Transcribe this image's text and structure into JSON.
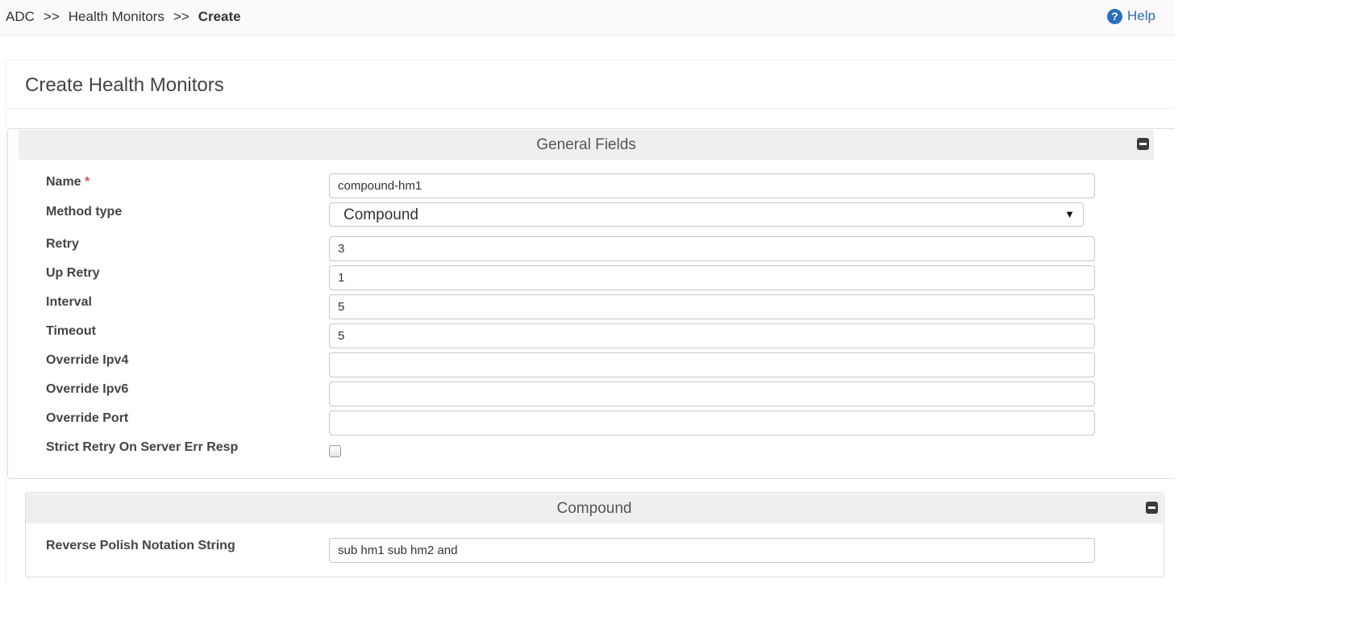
{
  "breadcrumb": {
    "root": "ADC",
    "sep1": ">>",
    "middle": "Health Monitors",
    "sep2": ">>",
    "current": "Create"
  },
  "help": {
    "icon": "question-circle-icon",
    "label": "Help",
    "color": "#2a6ebb"
  },
  "page_title": "Create Health Monitors",
  "general": {
    "title": "General Fields",
    "fields": {
      "name": {
        "label": "Name",
        "required_mark": "*",
        "value": "compound-hm1"
      },
      "method_type": {
        "label": "Method type",
        "value": "Compound",
        "caret": "▼"
      },
      "retry": {
        "label": "Retry",
        "value": "3"
      },
      "up_retry": {
        "label": "Up Retry",
        "value": "1"
      },
      "interval": {
        "label": "Interval",
        "value": "5"
      },
      "timeout": {
        "label": "Timeout",
        "value": "5"
      },
      "override_ipv4": {
        "label": "Override Ipv4",
        "value": ""
      },
      "override_ipv6": {
        "label": "Override Ipv6",
        "value": ""
      },
      "override_port": {
        "label": "Override Port",
        "value": ""
      },
      "strict_retry": {
        "label": "Strict Retry On Server Err Resp",
        "checked": false
      }
    }
  },
  "compound": {
    "title": "Compound",
    "rpn": {
      "label": "Reverse Polish Notation String",
      "value": "sub hm1 sub hm2 and"
    }
  }
}
